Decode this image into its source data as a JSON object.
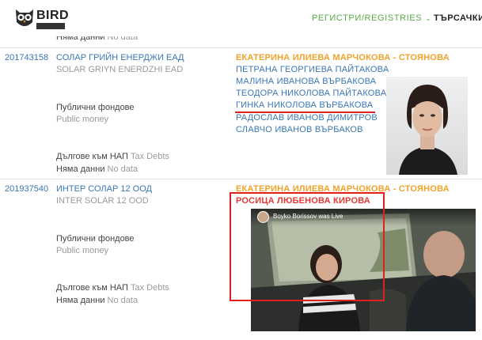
{
  "header": {
    "logo_text": "BIRD",
    "nav_registries": "РЕГИСТРИ/REGISTRIES",
    "nav_search": "ТЪРСАЧКИ/"
  },
  "top_partial": {
    "no_data_bg": "Няма данни",
    "no_data_en": "No data"
  },
  "rows": [
    {
      "id": "201743158",
      "name_bg": "СОЛАР ГРИЙН ЕНЕРДЖИ ЕАД",
      "name_en": "SOLAR GRIYN ENERDZHI EAD",
      "public_funds_bg": "Публични фондове",
      "public_funds_en": "Public money",
      "tax_debts_bg": "Дългове към НАП",
      "tax_debts_en": "Tax Debts",
      "no_data_bg": "Няма данни",
      "no_data_en": "No data",
      "people": [
        {
          "name": "ЕКАТЕРИНА ИЛИЕВА МАРЧОКОВА - СТОЯНОВА",
          "style": "orange"
        },
        {
          "name": "ПЕТРАНА ГЕОРГИЕВА ПАЙТАКОВА",
          "style": "blue"
        },
        {
          "name": "МАЛИНА ИВАНОВА ВЪРБАКОВА",
          "style": "blue"
        },
        {
          "name": "ТЕОДОРА НИКОЛОВА ПАЙТАКОВА",
          "style": "blue"
        },
        {
          "name": "ГИНКА НИКОЛОВА ВЪРБАКОВА",
          "style": "blue"
        },
        {
          "name": "РАДОСЛАВ ИВАНОВ ДИМИТРОВ",
          "style": "blue"
        },
        {
          "name": "СЛАВЧО ИВАНОВ ВЪРБАКОВ",
          "style": "blue"
        }
      ]
    },
    {
      "id": "201937540",
      "name_bg": "ИНТЕР СОЛАР 12 ООД",
      "name_en": "INTER SOLAR 12 OOD",
      "public_funds_bg": "Публични фондове",
      "public_funds_en": "Public money",
      "tax_debts_bg": "Дългове към НАП",
      "tax_debts_en": "Tax Debts",
      "no_data_bg": "Няма данни",
      "no_data_en": "No data",
      "people": [
        {
          "name": "ЕКАТЕРИНА ИЛИЕВА МАРЧОКОВА - СТОЯНОВА",
          "style": "orange"
        },
        {
          "name": "РОСИЦА ЛЮБЕНОВА КИРОВА",
          "style": "red"
        }
      ]
    }
  ],
  "video_overlay": {
    "caption": "Boyko Borissov was Live"
  },
  "colors": {
    "accent_green": "#5aaa46",
    "link_blue": "#3a77b4",
    "highlight_orange": "#f0a22a",
    "annotation_red": "#e01f1f"
  }
}
